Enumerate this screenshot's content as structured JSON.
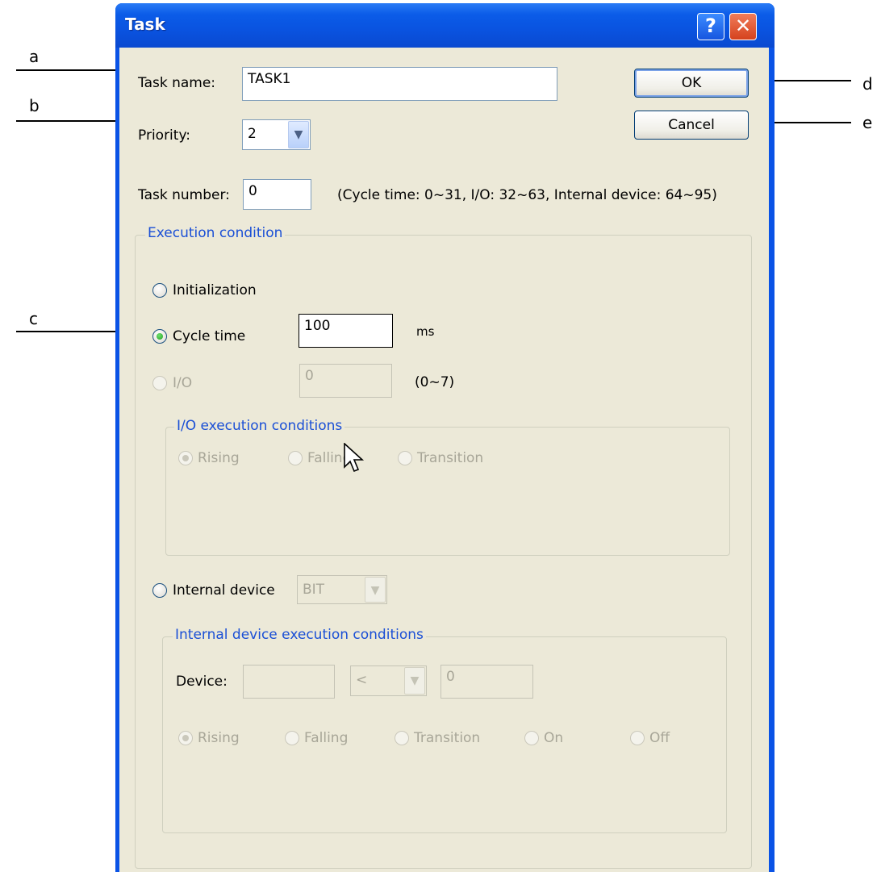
{
  "annotations": [
    "a",
    "b",
    "c",
    "d",
    "e"
  ],
  "window": {
    "title": "Task",
    "help": "?",
    "close": "✕"
  },
  "form": {
    "task_name_label": "Task name:",
    "task_name_value": "TASK1",
    "priority_label": "Priority:",
    "priority_value": "2",
    "task_number_label": "Task number:",
    "task_number_value": "0",
    "task_number_hint": "(Cycle time: 0~31, I/O: 32~63, Internal device: 64~95)"
  },
  "buttons": {
    "ok": "OK",
    "cancel": "Cancel"
  },
  "execution": {
    "legend": "Execution condition",
    "initialization": "Initialization",
    "cycle_time": "Cycle time",
    "cycle_time_value": "100",
    "cycle_time_unit": "ms",
    "io": "I/O",
    "io_value": "0",
    "io_range": "(0~7)",
    "selected": "cycle_time"
  },
  "io_conditions": {
    "legend": "I/O execution conditions",
    "rising": "Rising",
    "falling": "Falling",
    "transition": "Transition"
  },
  "internal": {
    "label": "Internal device",
    "type_value": "BIT"
  },
  "internal_conditions": {
    "legend": "Internal device execution conditions",
    "device_label": "Device:",
    "device_value": "",
    "operator_value": "<",
    "compare_value": "0",
    "rising": "Rising",
    "falling": "Falling",
    "transition": "Transition",
    "on": "On",
    "off": "Off"
  },
  "colors": {
    "title_bar": "#0a53e6",
    "client_bg": "#ece9d8",
    "legend_blue": "#1a4fd6",
    "close_red": "#d5421d"
  },
  "icons": {
    "help": "help-icon",
    "close": "close-icon",
    "dropdown": "chevron-down-icon",
    "cursor": "mouse-cursor-icon"
  }
}
